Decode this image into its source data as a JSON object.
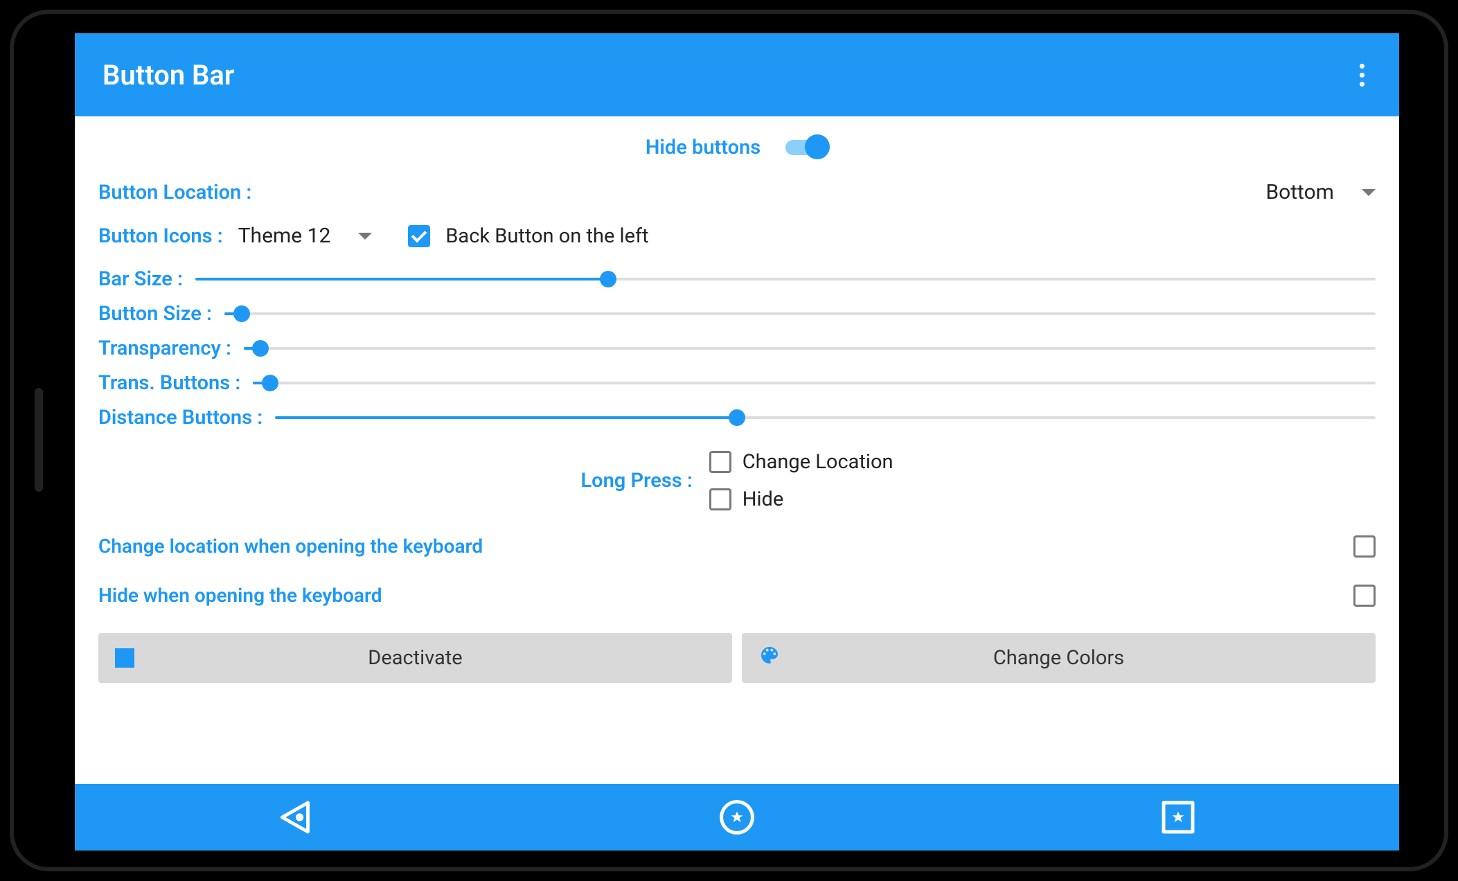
{
  "app": {
    "title": "Button Bar"
  },
  "main": {
    "hide_buttons_label": "Hide buttons",
    "hide_buttons_on": true,
    "location_label": "Button Location :",
    "location_value": "Bottom",
    "icons_label": "Button Icons :",
    "icons_value": "Theme 12",
    "back_left_label": "Back Button on the left",
    "back_left_checked": true,
    "sliders": {
      "bar_size": {
        "label": "Bar Size :",
        "pct": 35
      },
      "button_size": {
        "label": "Button Size :",
        "pct": 1.5
      },
      "transparency": {
        "label": "Transparency :",
        "pct": 1.5
      },
      "trans_btn": {
        "label": "Trans. Buttons :",
        "pct": 1.5
      },
      "distance": {
        "label": "Distance Buttons :",
        "pct": 42
      }
    },
    "long_press_label": "Long Press :",
    "long_press_opts": {
      "change_location": {
        "label": "Change Location",
        "checked": false
      },
      "hide": {
        "label": "Hide",
        "checked": false
      }
    },
    "keyboard_loc": {
      "label": "Change location when opening the keyboard",
      "checked": false
    },
    "keyboard_hide": {
      "label": "Hide when opening the keyboard",
      "checked": false
    },
    "deactivate_label": "Deactivate",
    "colors_label": "Change Colors"
  }
}
